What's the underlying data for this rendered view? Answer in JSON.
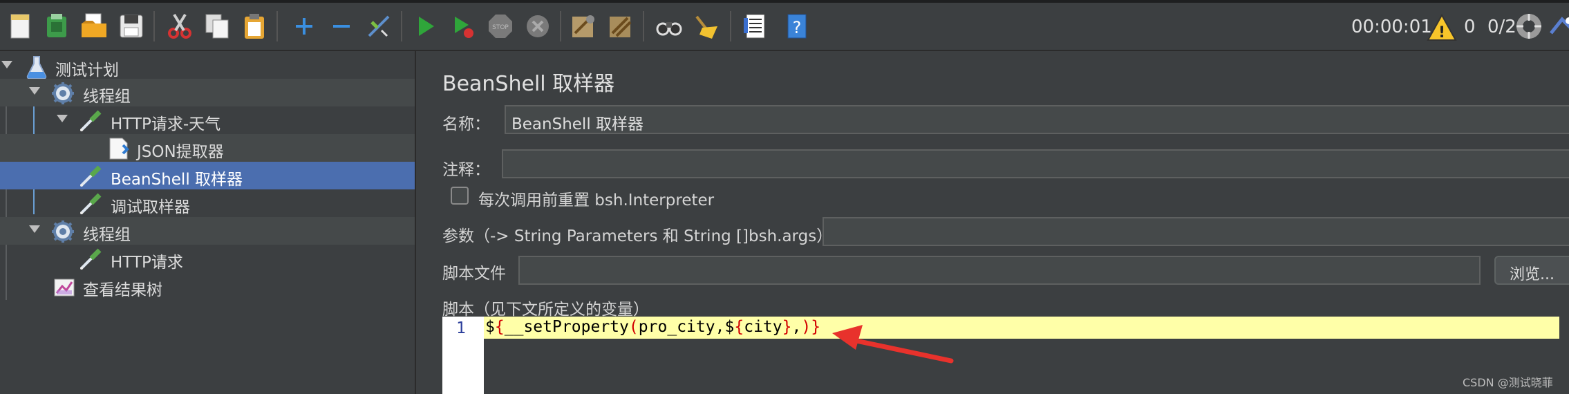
{
  "toolbar": {
    "timer": "00:00:01",
    "warning_count": "0",
    "threads": "0/2",
    "icons": [
      "new-icon",
      "templates-icon",
      "open-icon",
      "save-icon",
      "cut-icon",
      "copy-icon",
      "paste-icon",
      "expand-icon",
      "collapse-icon",
      "toggle-icon",
      "start-icon",
      "start-no-pause-icon",
      "stop-icon",
      "shutdown-icon",
      "clear-icon",
      "clear-all-icon",
      "search-icon",
      "reset-search-icon",
      "function-helper-icon",
      "help-icon",
      "warning-icon",
      "remote-icon"
    ]
  },
  "tree": {
    "items": [
      {
        "label": "测试计划"
      },
      {
        "label": "线程组"
      },
      {
        "label": "HTTP请求-天气"
      },
      {
        "label": "JSON提取器"
      },
      {
        "label": "BeanShell 取样器"
      },
      {
        "label": "调试取样器"
      },
      {
        "label": "线程组"
      },
      {
        "label": "HTTP请求"
      },
      {
        "label": "查看结果树"
      }
    ]
  },
  "panel": {
    "title": "BeanShell 取样器",
    "name_label": "名称：",
    "name_value": "BeanShell 取样器",
    "comment_label": "注释：",
    "comment_value": "",
    "reset_label": "每次调用前重置 bsh.Interpreter",
    "params_label": "参数（-> String Parameters 和 String []bsh.args）",
    "params_value": "",
    "script_file_label": "脚本文件",
    "script_file_value": "",
    "browse_label": "浏览...",
    "script_label": "脚本（见下文所定义的变量）"
  },
  "editor": {
    "line_number": "1",
    "code": "${__setProperty(pro_city,${city},)}"
  },
  "watermark": "CSDN @测试晓菲",
  "colors": {
    "selection": "#4b6eaf",
    "current_line": "#ffffa8",
    "arrow": "#e8322c"
  }
}
